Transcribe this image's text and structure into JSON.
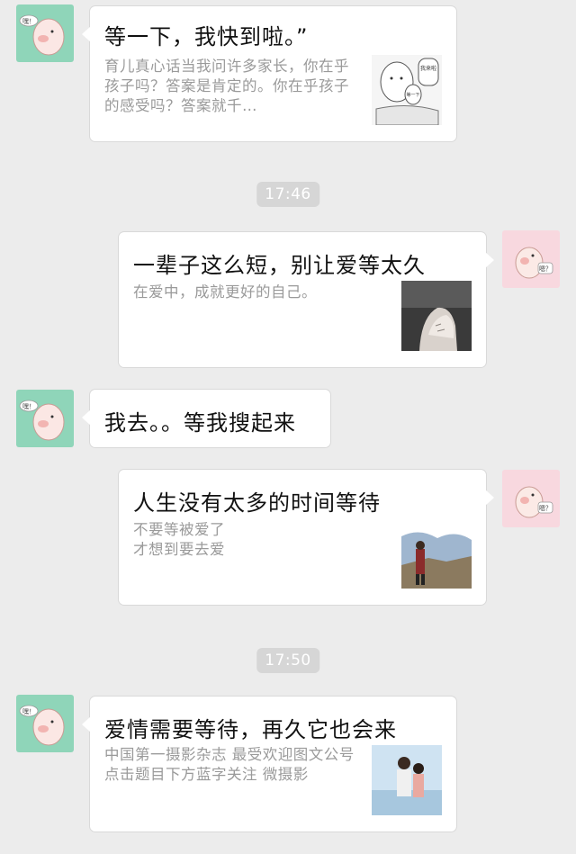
{
  "chat": {
    "messages": [
      {
        "title": "等一下，我快到啦。”",
        "desc": "育儿真心话当我问许多家长，你在乎孩子吗？答案是肯定的。你在乎孩子的感受吗？答案就千…",
        "avatar": "pig-avatar-green",
        "thumb_text_1": "我来啦",
        "thumb_text_2": "等一下"
      },
      {
        "time": "17:46"
      },
      {
        "title": "一辈子这么短，别让爱等太久",
        "desc": "在爱中，成就更好的自己。",
        "avatar": "pig-avatar-pink",
        "avatar_text": "嗯？"
      },
      {
        "text": "我去。。等我搜起来",
        "avatar": "pig-avatar-green"
      },
      {
        "title": "人生没有太多的时间等待",
        "desc_line1": "不要等被爱了",
        "desc_line2": "才想到要去爱",
        "avatar": "pig-avatar-pink",
        "avatar_text": "嗯？"
      },
      {
        "time": "17:50"
      },
      {
        "title": "爱情需要等待，再久它也会来",
        "desc": "中国第一摄影杂志 最受欢迎图文公号点击题目下方蓝字关注 微摄影",
        "avatar": "pig-avatar-green"
      }
    ],
    "avatar_green_text": "嘿！",
    "colors": {
      "background": "#ececec",
      "green_avatar": "#8fd5b9",
      "pink_avatar": "#f8d8df",
      "time_badge": "#d6d6d6"
    }
  }
}
